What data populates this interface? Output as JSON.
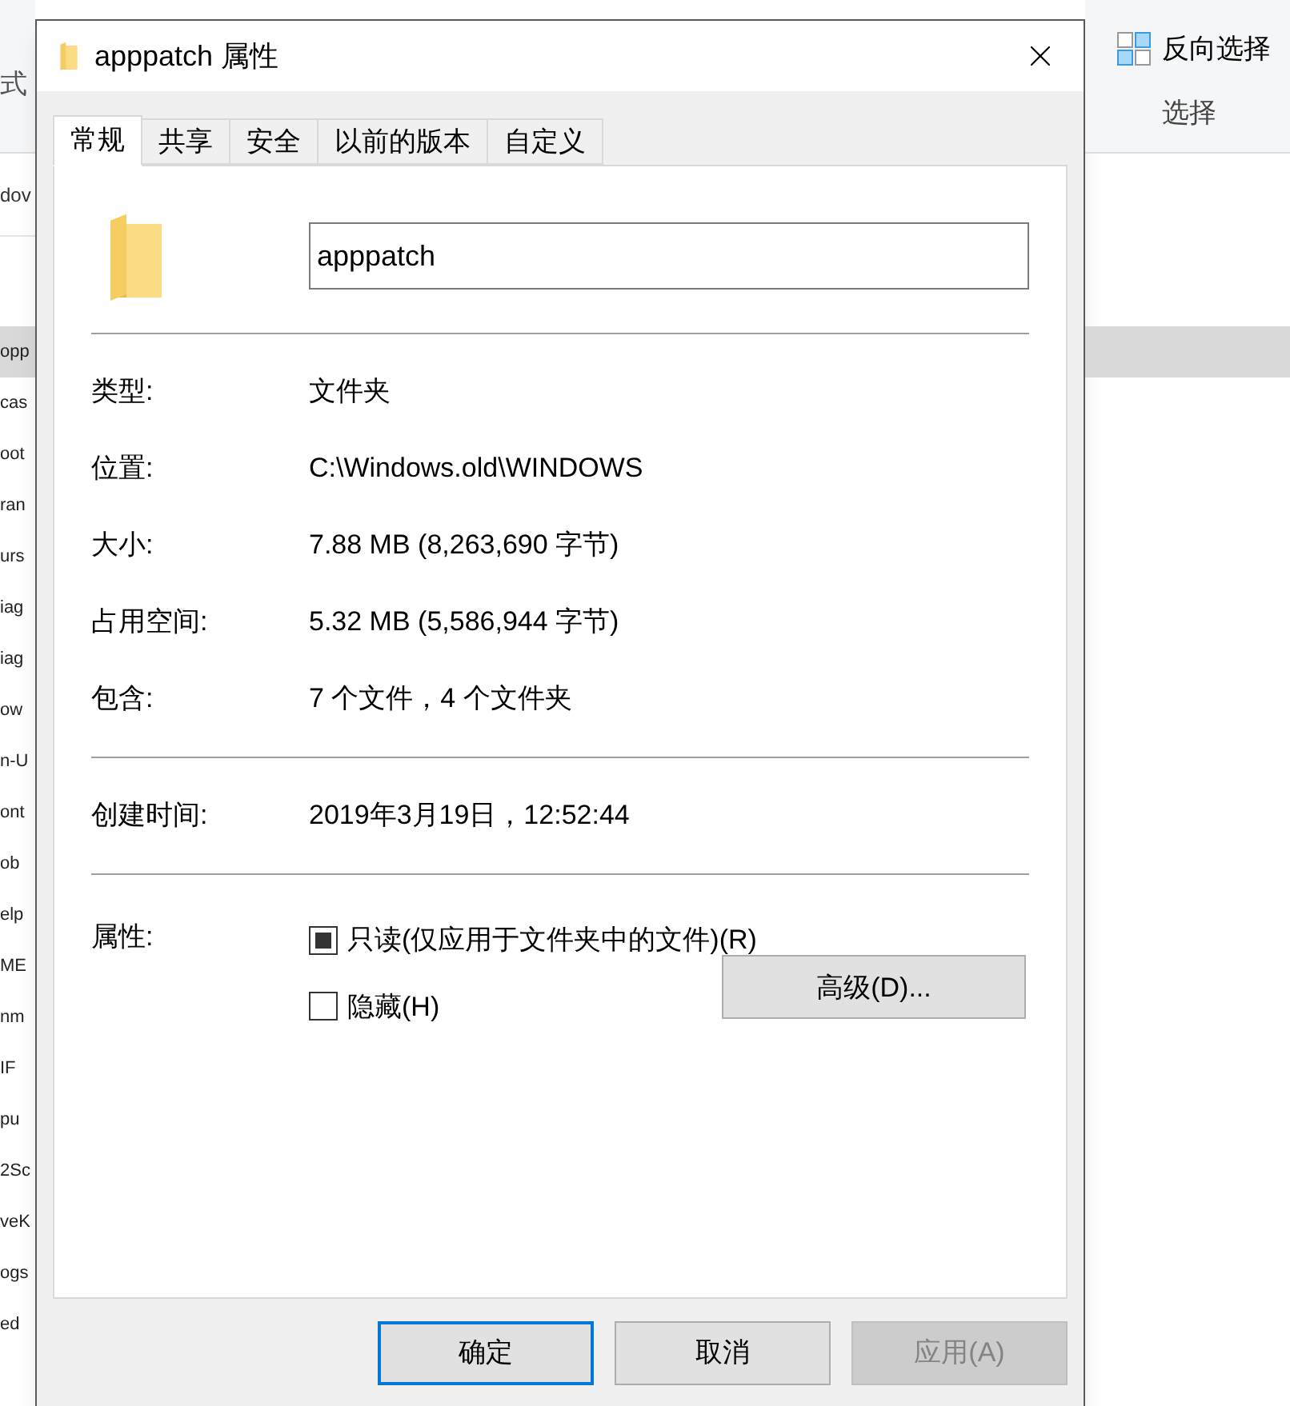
{
  "background": {
    "left_fragments": [
      "式",
      "dov"
    ],
    "list_fragments": [
      {
        "text": "opp",
        "selected": true
      },
      {
        "text": "cas",
        "selected": false
      },
      {
        "text": "oot",
        "selected": false
      },
      {
        "text": "ran",
        "selected": false
      },
      {
        "text": "urs",
        "selected": false
      },
      {
        "text": "iag",
        "selected": false
      },
      {
        "text": "iag",
        "selected": false
      },
      {
        "text": "ow",
        "selected": false
      },
      {
        "text": "n-U",
        "selected": false
      },
      {
        "text": "ont",
        "selected": false
      },
      {
        "text": "ob",
        "selected": false
      },
      {
        "text": "elp",
        "selected": false
      },
      {
        "text": "ME",
        "selected": false
      },
      {
        "text": "nm",
        "selected": false
      },
      {
        "text": "IF",
        "selected": false
      },
      {
        "text": "pu",
        "selected": false
      },
      {
        "text": "2Sc",
        "selected": false
      },
      {
        "text": "veK",
        "selected": false
      },
      {
        "text": "ogs",
        "selected": false
      },
      {
        "text": "ed",
        "selected": false
      }
    ],
    "ribbon": {
      "invert_selection": "反向选择",
      "group_label": "选择"
    }
  },
  "window": {
    "title": "apppatch 属性"
  },
  "tabs": [
    {
      "label": "常规",
      "selected": true
    },
    {
      "label": "共享",
      "selected": false
    },
    {
      "label": "安全",
      "selected": false
    },
    {
      "label": "以前的版本",
      "selected": false
    },
    {
      "label": "自定义",
      "selected": false
    }
  ],
  "name_field": {
    "value": "apppatch"
  },
  "info_groups": [
    [
      {
        "label": "类型:",
        "value": "文件夹"
      },
      {
        "label": "位置:",
        "value": "C:\\Windows.old\\WINDOWS"
      },
      {
        "label": "大小:",
        "value": "7.88 MB (8,263,690 字节)"
      },
      {
        "label": "占用空间:",
        "value": "5.32 MB (5,586,944 字节)"
      },
      {
        "label": "包含:",
        "value": "7 个文件，4 个文件夹"
      }
    ],
    [
      {
        "label": "创建时间:",
        "value": "2019年3月19日，12:52:44"
      }
    ]
  ],
  "attributes": {
    "label": "属性:",
    "options": [
      {
        "label": "只读(仅应用于文件夹中的文件)(R)",
        "checked": true
      },
      {
        "label": "隐藏(H)",
        "checked": false
      }
    ],
    "advanced_button": "高级(D)..."
  },
  "buttons": [
    {
      "label": "确定",
      "default": true,
      "disabled": false
    },
    {
      "label": "取消",
      "default": false,
      "disabled": false
    },
    {
      "label": "应用(A)",
      "default": false,
      "disabled": true
    }
  ]
}
